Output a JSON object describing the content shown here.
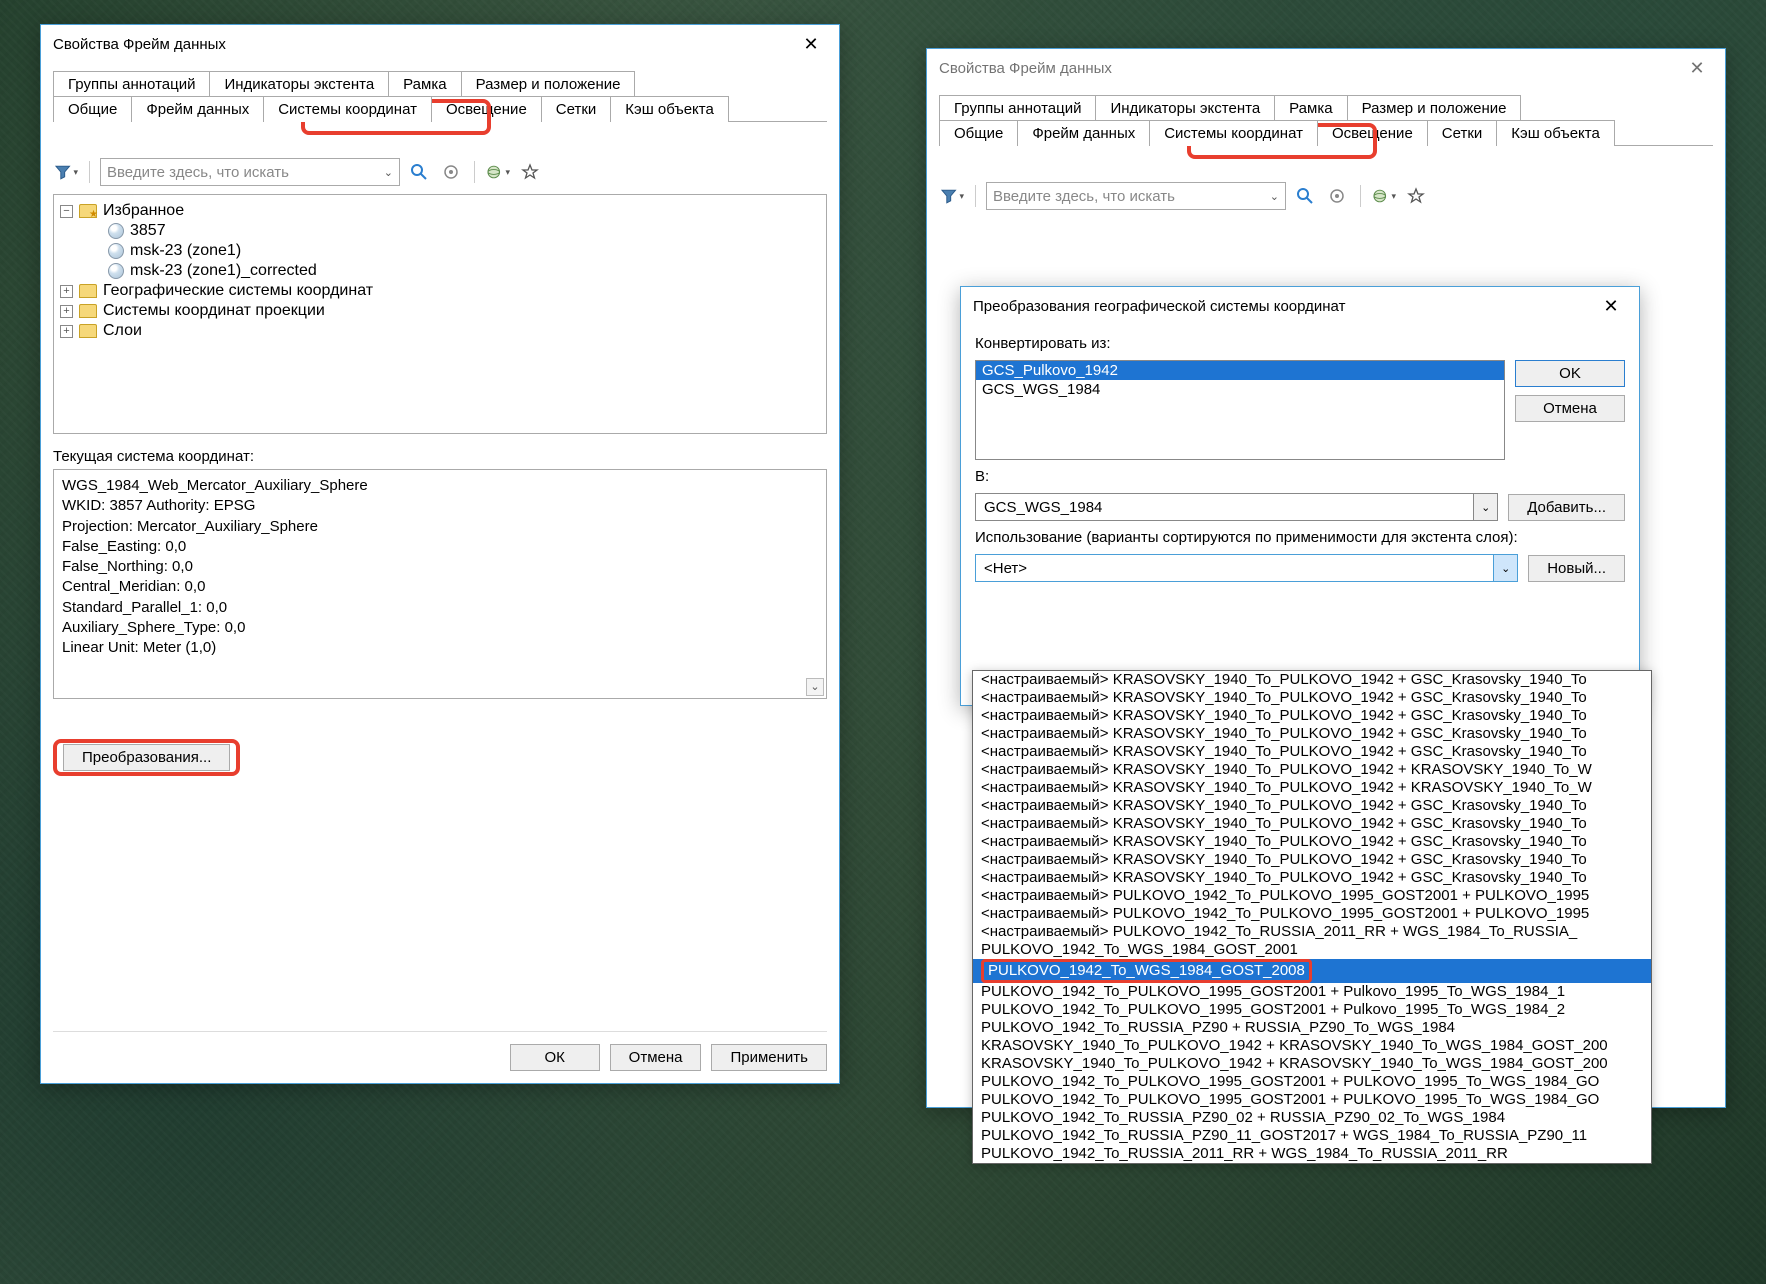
{
  "leftWindow": {
    "title": "Свойства Фрейм данных",
    "tabsRow1": [
      "Группы аннотаций",
      "Индикаторы экстента",
      "Рамка",
      "Размер и положение"
    ],
    "tabsRow2": [
      "Общие",
      "Фрейм данных",
      "Системы координат",
      "Освещение",
      "Сетки",
      "Кэш объекта"
    ],
    "activeTab": "Системы координат",
    "searchPlaceholder": "Введите здесь, что искать",
    "tree": {
      "favorites": "Избранное",
      "items": [
        "3857",
        "msk-23 (zone1)",
        "msk-23 (zone1)_corrected"
      ],
      "folders": [
        "Географические системы координат",
        "Системы координат проекции",
        "Слои"
      ]
    },
    "currentLabel": "Текущая система координат:",
    "currentDetails": [
      "WGS_1984_Web_Mercator_Auxiliary_Sphere",
      "WKID: 3857 Authority: EPSG",
      "",
      "Projection: Mercator_Auxiliary_Sphere",
      "False_Easting: 0,0",
      "False_Northing: 0,0",
      "Central_Meridian: 0,0",
      "Standard_Parallel_1: 0,0",
      "Auxiliary_Sphere_Type: 0,0",
      "Linear Unit: Meter (1,0)"
    ],
    "transformsBtn": "Преобразования...",
    "ok": "ОК",
    "cancel": "Отмена",
    "apply": "Применить"
  },
  "rightWindow": {
    "title": "Свойства Фрейм данных",
    "tabsRow1": [
      "Группы аннотаций",
      "Индикаторы экстента",
      "Рамка",
      "Размер и положение"
    ],
    "tabsRow2": [
      "Общие",
      "Фрейм данных",
      "Системы координат",
      "Освещение",
      "Сетки",
      "Кэш объекта"
    ],
    "activeTab": "Системы координат",
    "searchPlaceholder": "Введите здесь, что искать"
  },
  "subDialog": {
    "title": "Преобразования географической системы координат",
    "convertFrom": "Конвертировать из:",
    "fromList": [
      "GCS_Pulkovo_1942",
      "GCS_WGS_1984"
    ],
    "fromSelected": "GCS_Pulkovo_1942",
    "ok": "OK",
    "cancel": "Отмена",
    "toLabel": "В:",
    "toValue": "GCS_WGS_1984",
    "addBtn": "Добавить...",
    "useLabel": "Использование (варианты сортируются по применимости для экстента слоя):",
    "useValue": "<Нет>",
    "newBtn": "Новый...",
    "list": [
      "<настраиваемый> KRASOVSKY_1940_To_PULKOVO_1942 + GSC_Krasovsky_1940_To",
      "<настраиваемый> KRASOVSKY_1940_To_PULKOVO_1942 + GSC_Krasovsky_1940_To",
      "<настраиваемый> KRASOVSKY_1940_To_PULKOVO_1942 + GSC_Krasovsky_1940_To",
      "<настраиваемый> KRASOVSKY_1940_To_PULKOVO_1942 + GSC_Krasovsky_1940_To",
      "<настраиваемый> KRASOVSKY_1940_To_PULKOVO_1942 + GSC_Krasovsky_1940_To",
      "<настраиваемый> KRASOVSKY_1940_To_PULKOVO_1942 + KRASOVSKY_1940_To_W",
      "<настраиваемый> KRASOVSKY_1940_To_PULKOVO_1942 + KRASOVSKY_1940_To_W",
      "<настраиваемый> KRASOVSKY_1940_To_PULKOVO_1942 + GSC_Krasovsky_1940_To",
      "<настраиваемый> KRASOVSKY_1940_To_PULKOVO_1942 + GSC_Krasovsky_1940_To",
      "<настраиваемый> KRASOVSKY_1940_To_PULKOVO_1942 + GSC_Krasovsky_1940_To",
      "<настраиваемый> KRASOVSKY_1940_To_PULKOVO_1942 + GSC_Krasovsky_1940_To",
      "<настраиваемый> KRASOVSKY_1940_To_PULKOVO_1942 + GSC_Krasovsky_1940_To",
      "<настраиваемый> PULKOVO_1942_To_PULKOVO_1995_GOST2001 + PULKOVO_1995",
      "<настраиваемый> PULKOVO_1942_To_PULKOVO_1995_GOST2001 + PULKOVO_1995",
      "<настраиваемый> PULKOVO_1942_To_RUSSIA_2011_RR + WGS_1984_To_RUSSIA_",
      "PULKOVO_1942_To_WGS_1984_GOST_2001",
      "PULKOVO_1942_To_WGS_1984_GOST_2008",
      "PULKOVO_1942_To_PULKOVO_1995_GOST2001 + Pulkovo_1995_To_WGS_1984_1",
      "PULKOVO_1942_To_PULKOVO_1995_GOST2001 + Pulkovo_1995_To_WGS_1984_2",
      "PULKOVO_1942_To_RUSSIA_PZ90 + RUSSIA_PZ90_To_WGS_1984",
      "KRASOVSKY_1940_To_PULKOVO_1942 + KRASOVSKY_1940_To_WGS_1984_GOST_200",
      "KRASOVSKY_1940_To_PULKOVO_1942 + KRASOVSKY_1940_To_WGS_1984_GOST_200",
      "PULKOVO_1942_To_PULKOVO_1995_GOST2001 + PULKOVO_1995_To_WGS_1984_GO",
      "PULKOVO_1942_To_PULKOVO_1995_GOST2001 + PULKOVO_1995_To_WGS_1984_GO",
      "PULKOVO_1942_To_RUSSIA_PZ90_02 + RUSSIA_PZ90_02_To_WGS_1984",
      "PULKOVO_1942_To_RUSSIA_PZ90_11_GOST2017 + WGS_1984_To_RUSSIA_PZ90_11",
      "PULKOVO_1942_To_RUSSIA_2011_RR + WGS_1984_To_RUSSIA_2011_RR"
    ],
    "selectedIndex": 16
  }
}
